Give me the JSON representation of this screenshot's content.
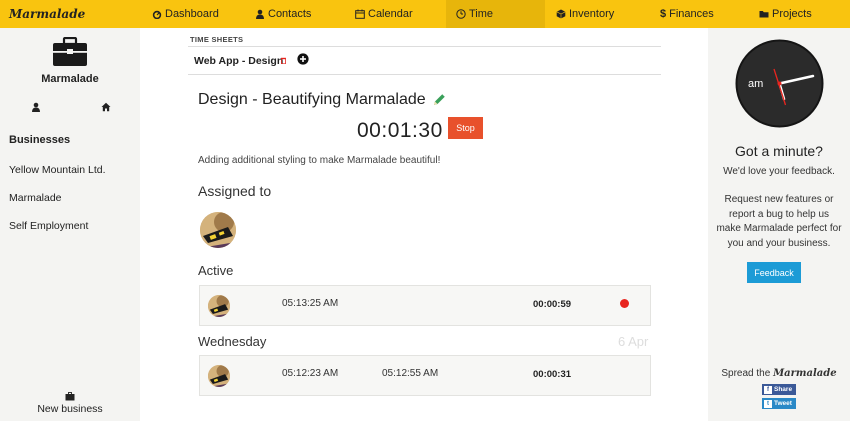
{
  "brand": "Marmalade",
  "nav": {
    "items": [
      {
        "label": "Dashboard",
        "icon": "dashboard-icon"
      },
      {
        "label": "Contacts",
        "icon": "user-icon"
      },
      {
        "label": "Calendar",
        "icon": "calendar-icon"
      },
      {
        "label": "Time",
        "icon": "clock-icon",
        "active": true
      },
      {
        "label": "Inventory",
        "icon": "cube-icon"
      },
      {
        "label": "Finances",
        "icon": "dollar-icon"
      },
      {
        "label": "Projects",
        "icon": "folder-icon"
      }
    ]
  },
  "sidebar": {
    "title": "Marmalade",
    "heading": "Businesses",
    "businesses": [
      "Yellow Mountain Ltd.",
      "Marmalade",
      "Self Employment"
    ],
    "new_business": "New business"
  },
  "main": {
    "section_label": "TIME SHEETS",
    "tab_label": "Web App - Design",
    "task_title": "Design - Beautifying Marmalade",
    "timer": "00:01:30",
    "stop_label": "Stop",
    "description": "Adding additional styling to make Marmalade beautiful!",
    "assigned_heading": "Assigned to",
    "active_heading": "Active",
    "active_entry": {
      "start": "05:13:25 AM",
      "duration": "00:00:59"
    },
    "day_heading": "Wednesday",
    "day_date": "6 Apr",
    "day_entry": {
      "start": "05:12:23 AM",
      "end": "05:12:55 AM",
      "duration": "00:00:31"
    }
  },
  "right": {
    "clock_label": "am",
    "title": "Got a minute?",
    "subtitle": "We'd love your feedback.",
    "text": "Request new features or report a bug to help us make Marmalade perfect for you and your business.",
    "feedback_label": "Feedback",
    "spread_prefix": "Spread the",
    "spread_brand": "Marmalade",
    "share_label": "Share",
    "tweet_label": "Tweet"
  },
  "colors": {
    "nav": "#f9c40f",
    "stop": "#e8512c",
    "feedback": "#1c9bd6",
    "recording": "#e8251f",
    "pencil": "#3aa05a"
  }
}
